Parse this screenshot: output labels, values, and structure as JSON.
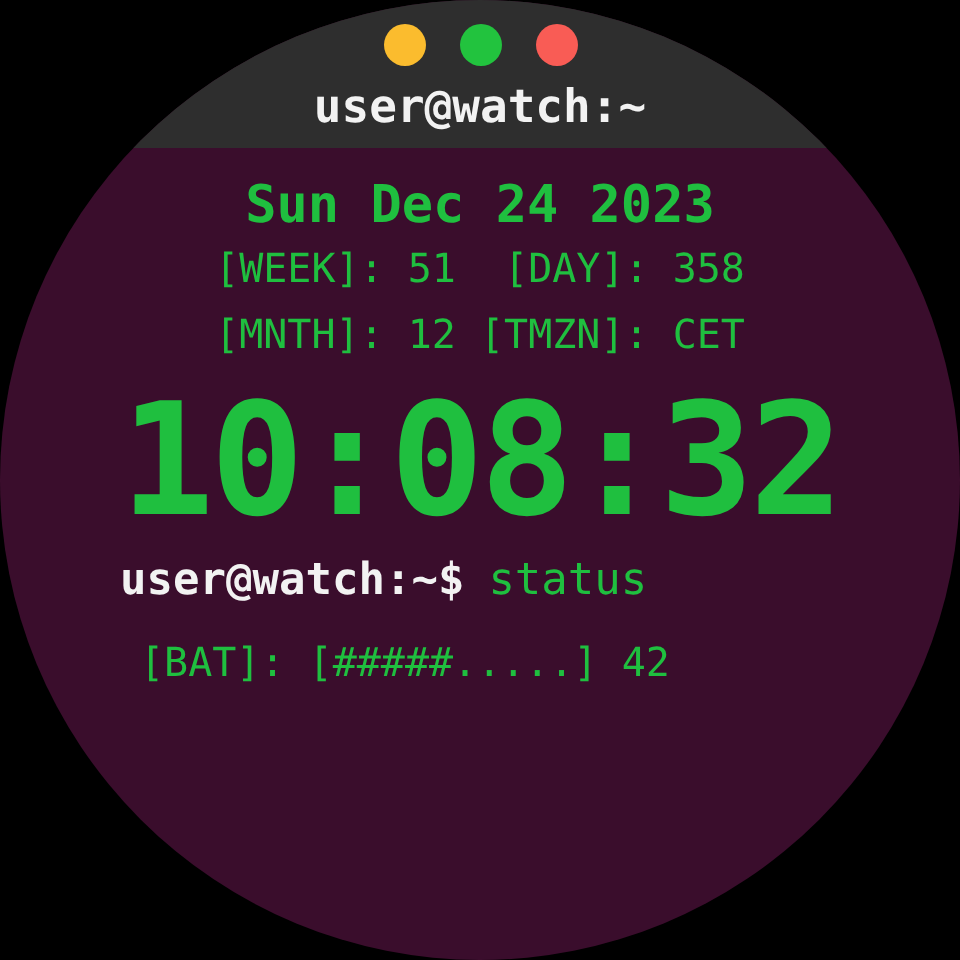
{
  "window": {
    "title": "user@watch:~",
    "controls": [
      {
        "color": "#fbbc2e"
      },
      {
        "color": "#22c33e"
      },
      {
        "color": "#f95c55"
      }
    ]
  },
  "date": "Sun Dec 24 2023",
  "info_lines": [
    "[WEEK]: 51  [DAY]: 358",
    "[MNTH]: 12 [TMZN]: CET"
  ],
  "time": "10:08:32",
  "prompt": {
    "user": "user@watch:~$",
    "command": "status"
  },
  "battery": "[BAT]: [#####.....] 42"
}
